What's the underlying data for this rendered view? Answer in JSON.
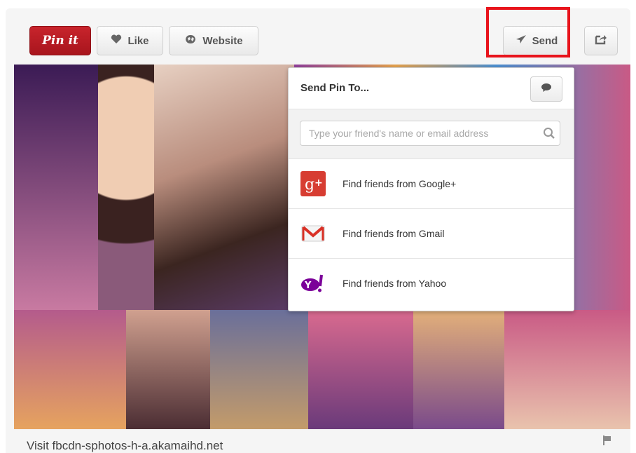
{
  "toolbar": {
    "pinit_label": "Pin it",
    "like_label": "Like",
    "website_label": "Website",
    "send_label": "Send"
  },
  "send_dropdown": {
    "title": "Send Pin To...",
    "search_placeholder": "Type your friend's name or email address",
    "options": [
      {
        "label": "Find friends from Google+",
        "icon": "google-plus-icon",
        "color": "#d73d32"
      },
      {
        "label": "Find friends from Gmail",
        "icon": "gmail-icon",
        "color": "#d93025"
      },
      {
        "label": "Find friends from Yahoo",
        "icon": "yahoo-icon",
        "color": "#7b0099"
      }
    ]
  },
  "footer": {
    "visit_text": "Visit fbcdn-sphotos-h-a.akamaihd.net"
  },
  "colors": {
    "pinit_red": "#b81a22",
    "highlight_red": "#e8141c"
  }
}
